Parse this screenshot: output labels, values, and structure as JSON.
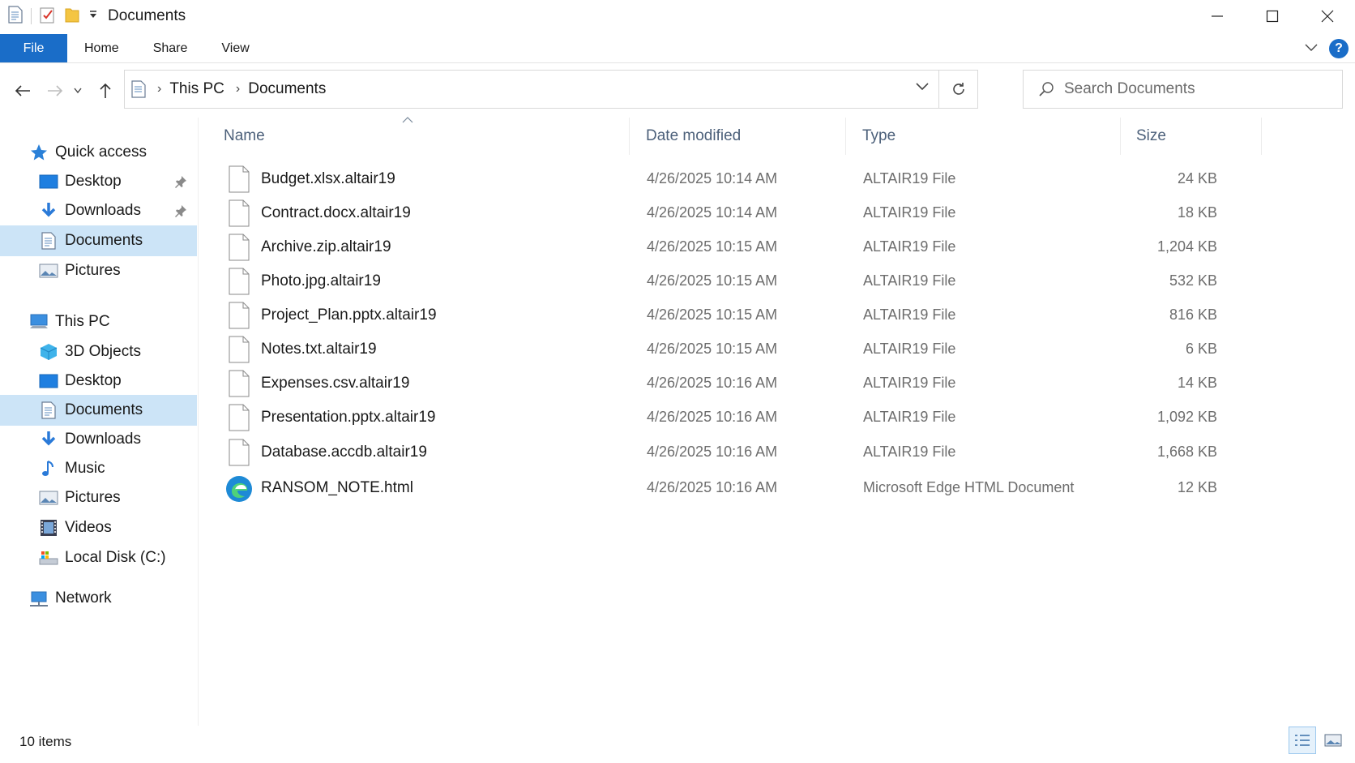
{
  "window": {
    "title": "Documents",
    "controls": {
      "minimize": "minimize-icon",
      "maximize": "maximize-icon",
      "close": "close-icon"
    }
  },
  "ribbon": {
    "tabs": [
      "File",
      "Home",
      "Share",
      "View"
    ]
  },
  "address": {
    "crumbs": [
      "This PC",
      "Documents"
    ]
  },
  "search": {
    "placeholder": "Search Documents"
  },
  "sidebar": {
    "quick_access": {
      "label": "Quick access",
      "items": [
        {
          "label": "Desktop",
          "icon": "desktop-icon",
          "pinned": true
        },
        {
          "label": "Downloads",
          "icon": "downloads-icon",
          "pinned": true
        },
        {
          "label": "Documents",
          "icon": "documents-icon",
          "selected": true
        },
        {
          "label": "Pictures",
          "icon": "pictures-icon"
        }
      ]
    },
    "this_pc": {
      "label": "This PC",
      "items": [
        {
          "label": "3D Objects",
          "icon": "3d-objects-icon"
        },
        {
          "label": "Desktop",
          "icon": "desktop-icon"
        },
        {
          "label": "Documents",
          "icon": "documents-icon",
          "selected": true
        },
        {
          "label": "Downloads",
          "icon": "downloads-icon"
        },
        {
          "label": "Music",
          "icon": "music-icon"
        },
        {
          "label": "Pictures",
          "icon": "pictures-icon"
        },
        {
          "label": "Videos",
          "icon": "videos-icon"
        },
        {
          "label": "Local Disk (C:)",
          "icon": "local-disk-icon"
        }
      ]
    },
    "network": {
      "label": "Network"
    }
  },
  "columns": {
    "name": "Name",
    "date": "Date modified",
    "type": "Type",
    "size": "Size"
  },
  "files": [
    {
      "name": "Budget.xlsx.altair19",
      "date": "4/26/2025 10:14 AM",
      "type": "ALTAIR19 File",
      "size": "24 KB",
      "icon": "blank-file-icon"
    },
    {
      "name": "Contract.docx.altair19",
      "date": "4/26/2025 10:14 AM",
      "type": "ALTAIR19 File",
      "size": "18 KB",
      "icon": "blank-file-icon"
    },
    {
      "name": "Archive.zip.altair19",
      "date": "4/26/2025 10:15 AM",
      "type": "ALTAIR19 File",
      "size": "1,204 KB",
      "icon": "blank-file-icon"
    },
    {
      "name": "Photo.jpg.altair19",
      "date": "4/26/2025 10:15 AM",
      "type": "ALTAIR19 File",
      "size": "532 KB",
      "icon": "blank-file-icon"
    },
    {
      "name": "Project_Plan.pptx.altair19",
      "date": "4/26/2025 10:15 AM",
      "type": "ALTAIR19 File",
      "size": "816 KB",
      "icon": "blank-file-icon"
    },
    {
      "name": "Notes.txt.altair19",
      "date": "4/26/2025 10:15 AM",
      "type": "ALTAIR19 File",
      "size": "6 KB",
      "icon": "blank-file-icon"
    },
    {
      "name": "Expenses.csv.altair19",
      "date": "4/26/2025 10:16 AM",
      "type": "ALTAIR19 File",
      "size": "14 KB",
      "icon": "blank-file-icon"
    },
    {
      "name": "Presentation.pptx.altair19",
      "date": "4/26/2025 10:16 AM",
      "type": "ALTAIR19 File",
      "size": "1,092 KB",
      "icon": "blank-file-icon"
    },
    {
      "name": "Database.accdb.altair19",
      "date": "4/26/2025 10:16 AM",
      "type": "ALTAIR19 File",
      "size": "1,668 KB",
      "icon": "blank-file-icon"
    },
    {
      "name": "RANSOM_NOTE.html",
      "date": "4/26/2025 10:16 AM",
      "type": "Microsoft Edge HTML Document",
      "size": "12 KB",
      "icon": "edge-icon"
    }
  ],
  "status": {
    "count": "10 items"
  },
  "colors": {
    "accent": "#1a6dc8",
    "selected": "#cce4f7",
    "header_text": "#4c607a"
  }
}
